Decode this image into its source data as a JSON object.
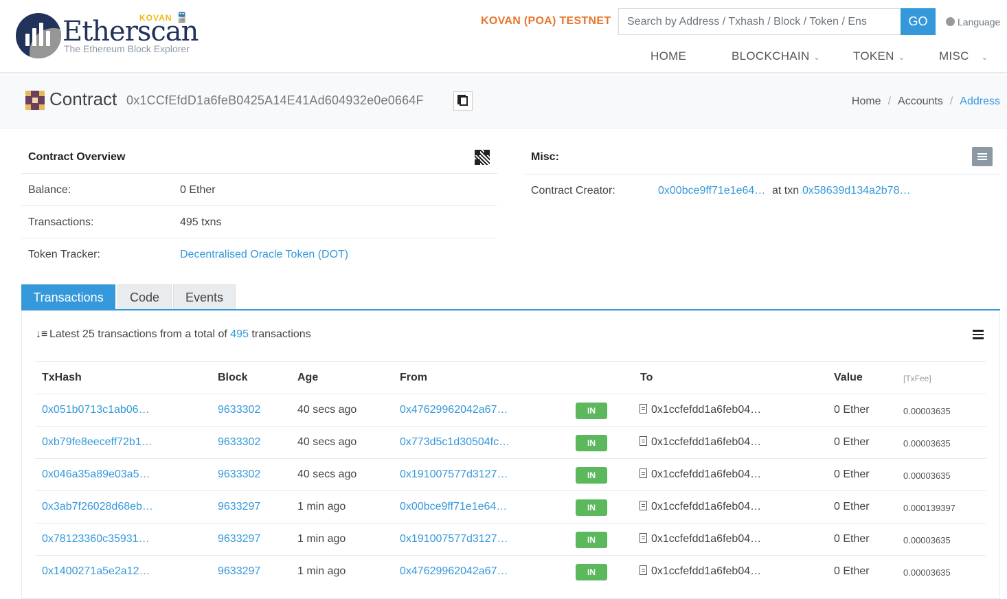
{
  "header": {
    "logo_text": "Etherscan",
    "logo_network": "KOVAN",
    "logo_subtitle": "The Ethereum Block Explorer",
    "network_label": "KOVAN (POA) TESTNET",
    "search_placeholder": "Search by Address / Txhash / Block / Token / Ens",
    "go_label": "GO",
    "language_label": "Language",
    "nav": [
      {
        "label": "HOME",
        "has_dropdown": false
      },
      {
        "label": "BLOCKCHAIN",
        "has_dropdown": true
      },
      {
        "label": "TOKEN",
        "has_dropdown": true
      },
      {
        "label": "MISC",
        "has_dropdown": true
      }
    ]
  },
  "title": {
    "label": "Contract",
    "address": "0x1CCfEfdD1a6feB0425A14E41Ad604932e0e0664F"
  },
  "breadcrumb": [
    "Home",
    "Accounts",
    "Address"
  ],
  "overview": {
    "heading": "Contract Overview",
    "rows": [
      {
        "key": "Balance:",
        "value": "0 Ether"
      },
      {
        "key": "Transactions:",
        "value": "495 txns"
      },
      {
        "key": "Token Tracker:",
        "value": "Decentralised Oracle Token (DOT)"
      }
    ]
  },
  "misc": {
    "heading": "Misc:",
    "creator_label": "Contract Creator:",
    "creator_address": "0x00bce9ff71e1e64…",
    "at_txn_label": "at txn",
    "creator_txn": "0x58639d134a2b78…"
  },
  "tabs": [
    "Transactions",
    "Code",
    "Events"
  ],
  "summary": {
    "prefix": "Latest 25 transactions from a total of",
    "total": "495",
    "suffix": "transactions"
  },
  "table": {
    "headers": [
      "TxHash",
      "Block",
      "Age",
      "From",
      "To",
      "Value",
      "[TxFee]"
    ],
    "rows": [
      {
        "hash": "0x051b0713c1ab06…",
        "block": "9633302",
        "age": "40 secs ago",
        "from": "0x47629962042a67…",
        "dir": "IN",
        "to": "0x1ccfefdd1a6feb04…",
        "value": "0 Ether",
        "fee": "0.00003635"
      },
      {
        "hash": "0xb79fe8eeceff72b1…",
        "block": "9633302",
        "age": "40 secs ago",
        "from": "0x773d5c1d30504fc…",
        "dir": "IN",
        "to": "0x1ccfefdd1a6feb04…",
        "value": "0 Ether",
        "fee": "0.00003635"
      },
      {
        "hash": "0x046a35a89e03a5…",
        "block": "9633302",
        "age": "40 secs ago",
        "from": "0x191007577d3127…",
        "dir": "IN",
        "to": "0x1ccfefdd1a6feb04…",
        "value": "0 Ether",
        "fee": "0.00003635"
      },
      {
        "hash": "0x3ab7f26028d68eb…",
        "block": "9633297",
        "age": "1 min ago",
        "from": "0x00bce9ff71e1e64…",
        "dir": "IN",
        "to": "0x1ccfefdd1a6feb04…",
        "value": "0 Ether",
        "fee": "0.000139397"
      },
      {
        "hash": "0x78123360c35931…",
        "block": "9633297",
        "age": "1 min ago",
        "from": "0x191007577d3127…",
        "dir": "IN",
        "to": "0x1ccfefdd1a6feb04…",
        "value": "0 Ether",
        "fee": "0.00003635"
      },
      {
        "hash": "0x1400271a5e2a12…",
        "block": "9633297",
        "age": "1 min ago",
        "from": "0x47629962042a67…",
        "dir": "IN",
        "to": "0x1ccfefdd1a6feb04…",
        "value": "0 Ether",
        "fee": "0.00003635"
      }
    ]
  }
}
